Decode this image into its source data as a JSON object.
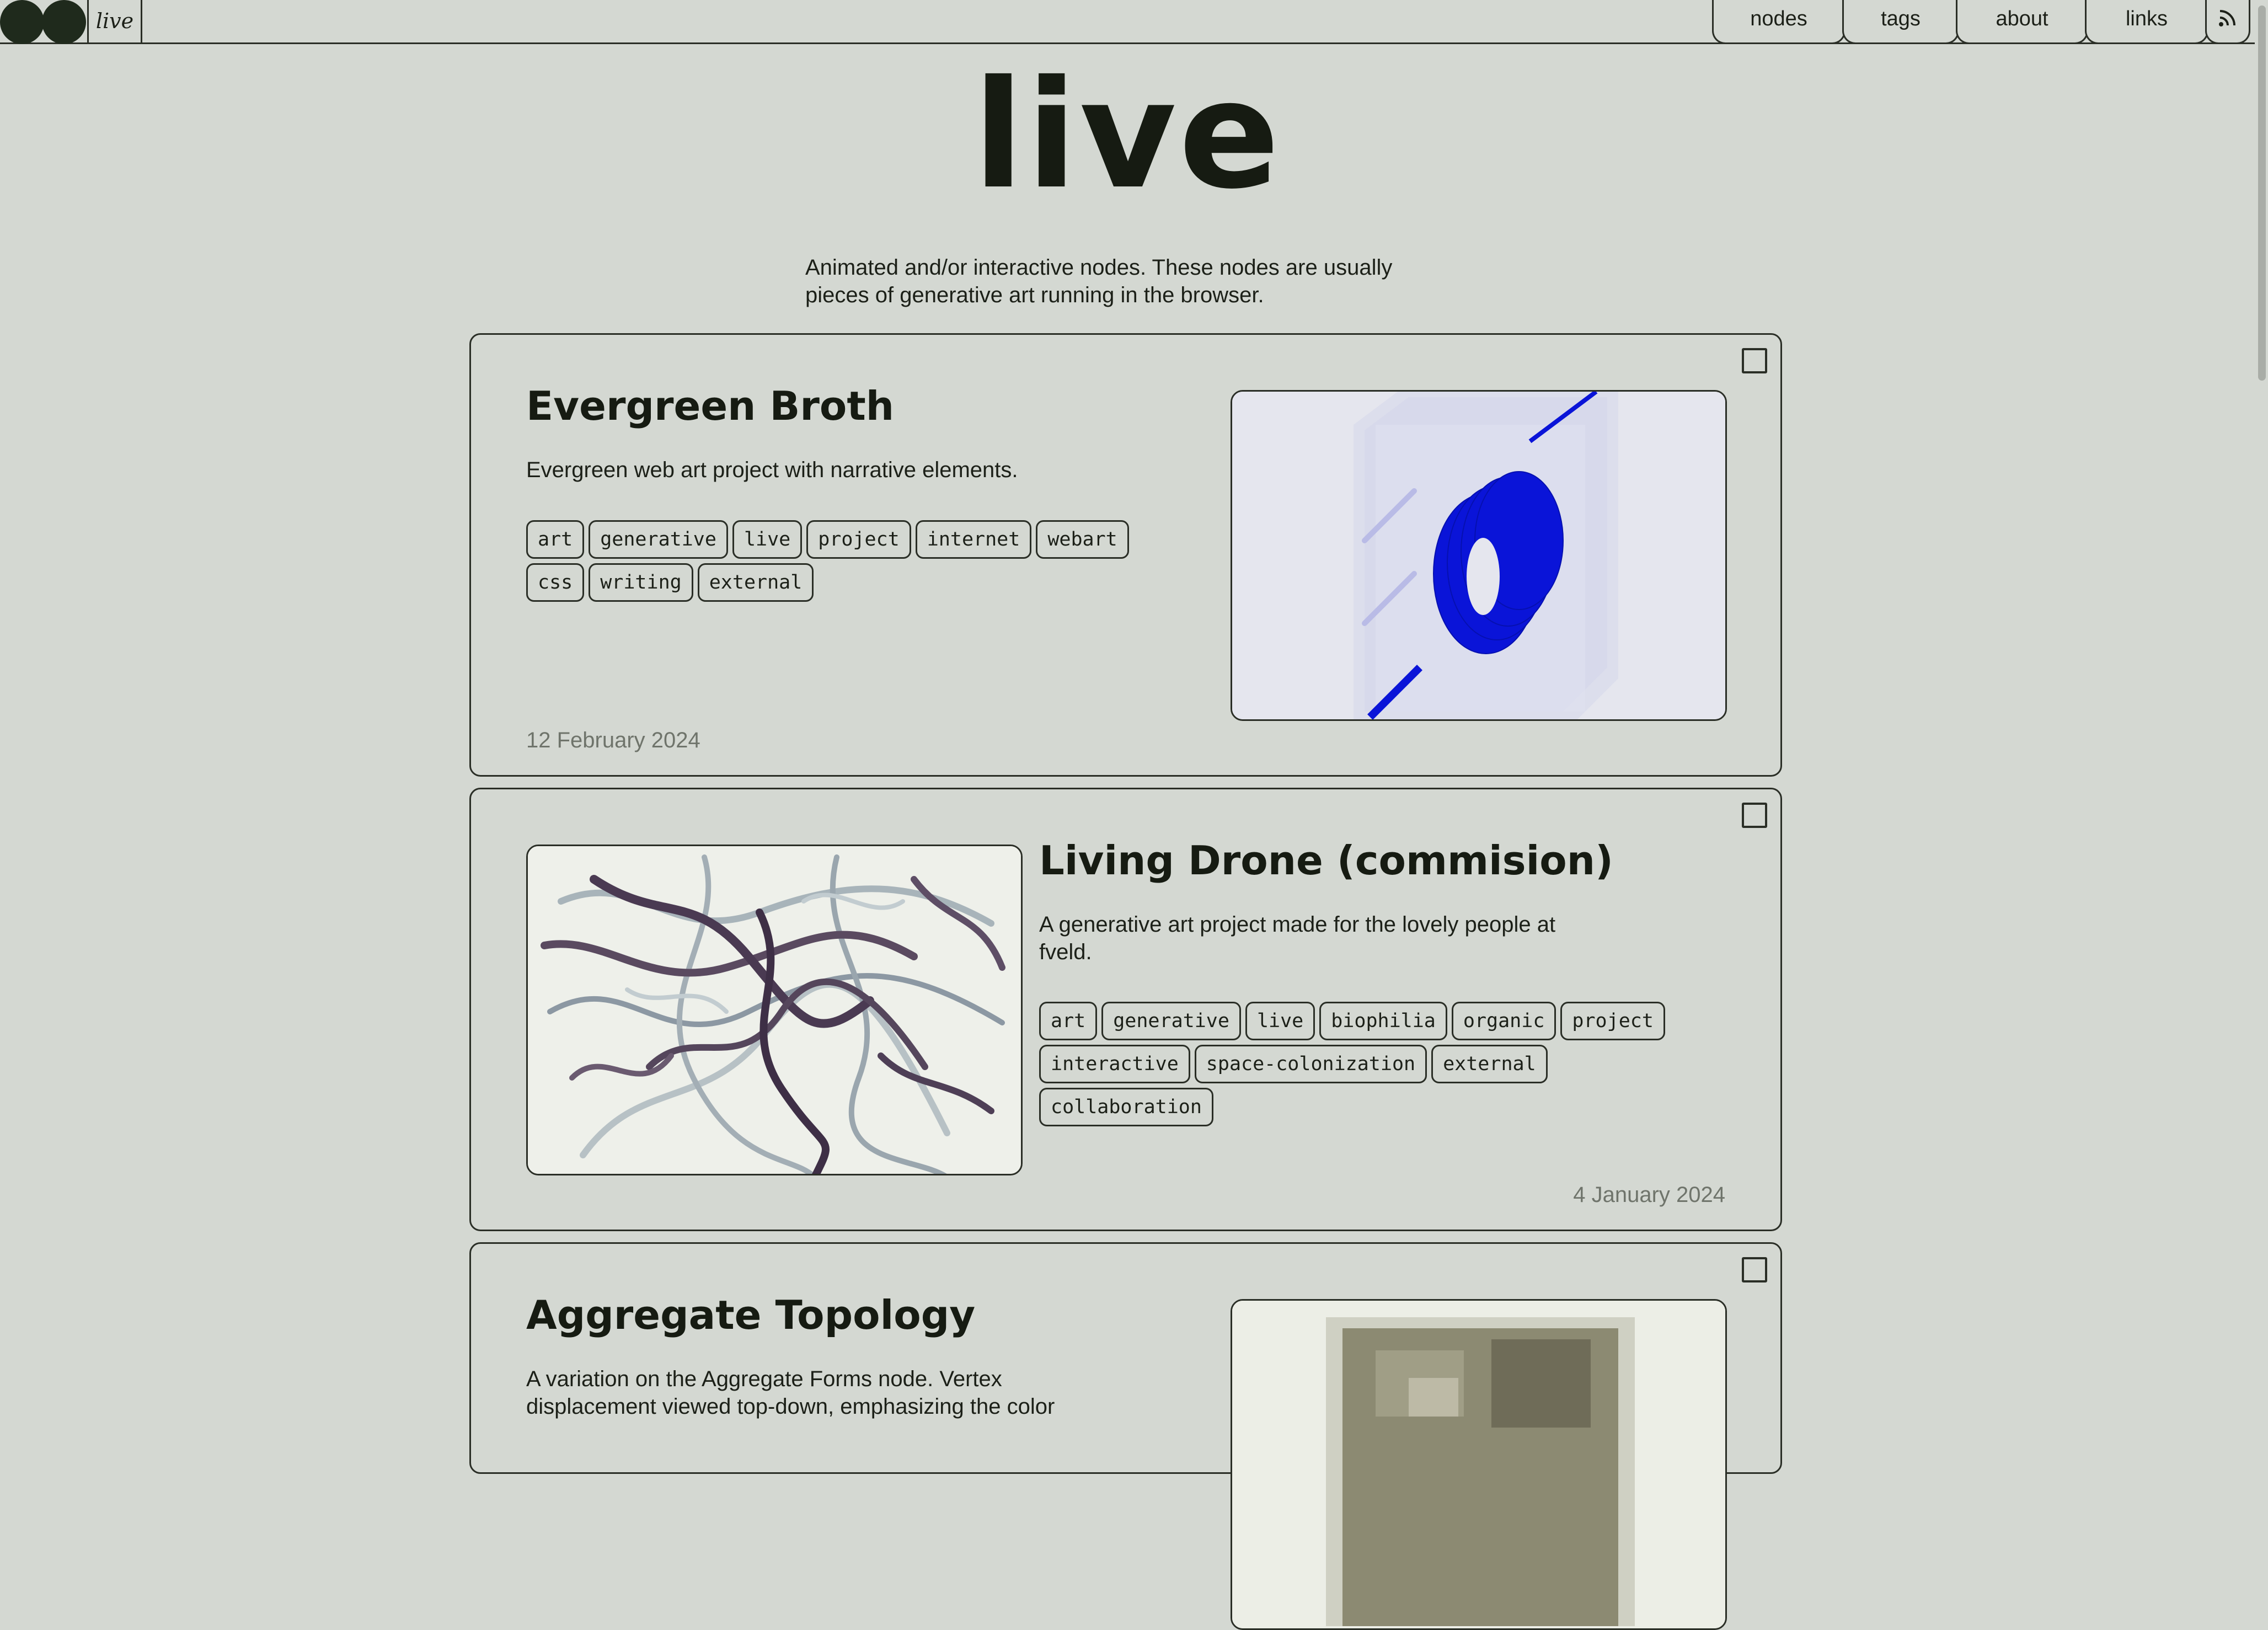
{
  "header": {
    "site_label": "live",
    "nav": [
      {
        "label": "nodes"
      },
      {
        "label": "tags"
      },
      {
        "label": "about"
      },
      {
        "label": "links"
      }
    ],
    "rss_icon": "rss-icon"
  },
  "page": {
    "title": "live",
    "description": "Animated and/or interactive nodes. These nodes are usually pieces of generative art running in the browser."
  },
  "cards": [
    {
      "title": "Evergreen Broth",
      "description": "Evergreen web art project with narrative elements.",
      "tags": [
        "art",
        "generative",
        "live",
        "project",
        "internet",
        "webart",
        "css",
        "writing",
        "external"
      ],
      "date": "12 February 2024"
    },
    {
      "title": "Living Drone (commision)",
      "description": "A generative art project made for the lovely people at fveld.",
      "tags": [
        "art",
        "generative",
        "live",
        "biophilia",
        "organic",
        "project",
        "interactive",
        "space-colonization",
        "external",
        "collaboration"
      ],
      "date": "4 January 2024"
    },
    {
      "title": "Aggregate Topology",
      "description": "A variation on the Aggregate Forms node. Vertex displacement viewed top-down, emphasizing the color",
      "tags": [],
      "date": ""
    }
  ],
  "colors": {
    "background": "#d4d8d2",
    "ink": "#1c2018",
    "accent_blue": "#0a14d8"
  }
}
